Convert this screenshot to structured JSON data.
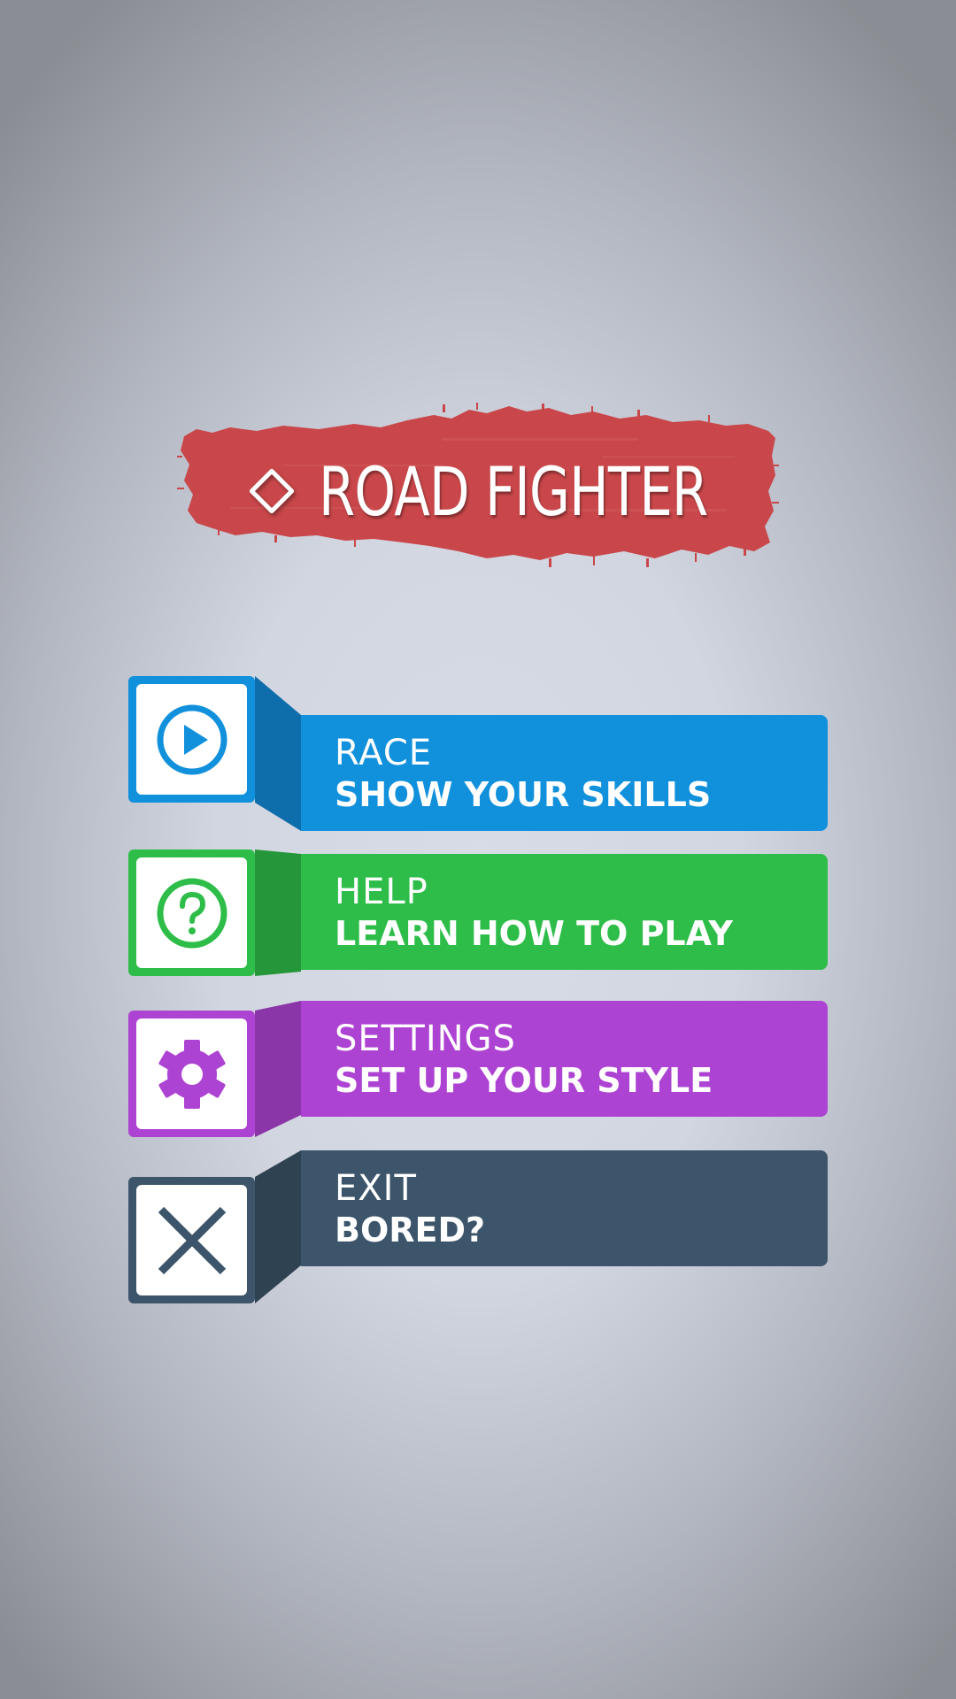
{
  "title": {
    "text": "ROAD FIGHTER",
    "brush_color": "#c9474a"
  },
  "menu": [
    {
      "id": "race",
      "title": "RACE",
      "subtitle": "SHOW YOUR SKILLS",
      "icon": "play-icon",
      "color": "#1190dc",
      "dark": "#0e6eac"
    },
    {
      "id": "help",
      "title": "HELP",
      "subtitle": "LEARN HOW TO PLAY",
      "icon": "help-icon",
      "color": "#2dbd48",
      "dark": "#25973a"
    },
    {
      "id": "settings",
      "title": "SETTINGS",
      "subtitle": "SET UP YOUR STYLE",
      "icon": "gear-icon",
      "color": "#ad43d2",
      "dark": "#8a35a8"
    },
    {
      "id": "exit",
      "title": "EXIT",
      "subtitle": "BORED?",
      "icon": "close-icon",
      "color": "#3c556a",
      "dark": "#2f4252"
    }
  ]
}
